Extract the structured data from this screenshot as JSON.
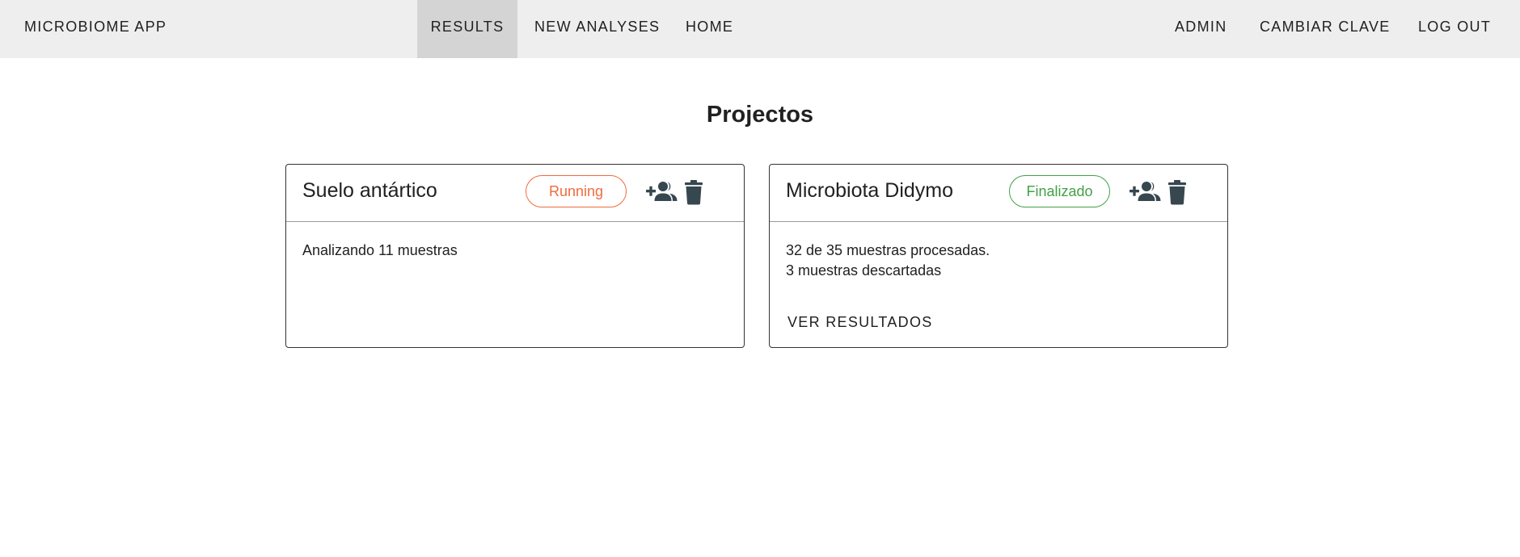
{
  "navbar": {
    "brand": "MICROBIOME APP",
    "left_items": [
      {
        "label": "RESULTS",
        "active": true
      },
      {
        "label": "NEW ANALYSES",
        "active": false
      },
      {
        "label": "HOME",
        "active": false
      }
    ],
    "right_items": [
      {
        "label": "ADMIN"
      },
      {
        "label": "CAMBIAR CLAVE"
      },
      {
        "label": "LOG OUT"
      }
    ]
  },
  "page": {
    "title": "Projectos"
  },
  "projects": [
    {
      "name": "Suelo antártico",
      "status": "Running",
      "status_color": "#ef6c3f",
      "lines": [
        "Analizando 11 muestras"
      ],
      "action": "",
      "icons": [
        "add-user-icon",
        "trash-icon"
      ]
    },
    {
      "name": "Microbiota Didymo",
      "status": "Finalizado",
      "status_color": "#43a047",
      "lines": [
        "32 de 35 muestras procesadas.",
        "3 muestras descartadas"
      ],
      "action": "VER RESULTADOS",
      "icons": [
        "add-user-icon",
        "trash-icon"
      ]
    }
  ],
  "colors": {
    "navbar_bg": "#eeeeee",
    "nav_active_bg": "#d4d4d4",
    "icon": "#37474f"
  }
}
